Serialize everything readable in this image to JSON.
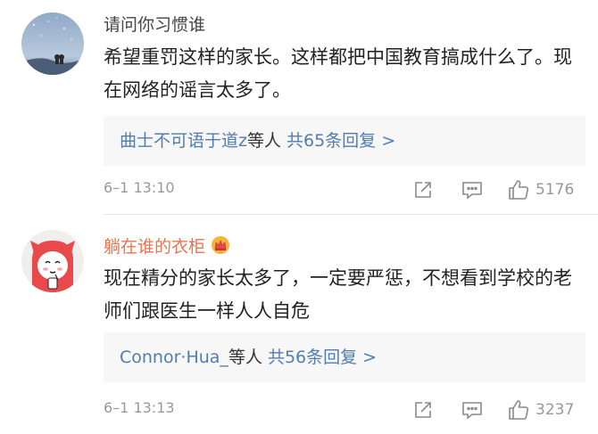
{
  "comments": [
    {
      "username": "请问你习惯谁",
      "text": "希望重罚这样的家长。这样都把中国教育搞成什么了。现在网络的谣言太多了。",
      "replies": {
        "names": "曲士不可语于道z",
        "suffix": "等人",
        "count": "共65条回复 >"
      },
      "time": "6–1 13:10",
      "likes": "5176"
    },
    {
      "username": "躺在谁的衣柜",
      "text": "现在精分的家长太多了，一定要严惩，不想看到学校的老师们跟医生一样人人自危",
      "replies": {
        "names": "Connor·Hua_",
        "suffix": "等人",
        "count": "共56条回复 >"
      },
      "time": "6–1 13:13",
      "likes": "3237"
    }
  ],
  "colors": {
    "link": "#507daf",
    "username_vip": "#eb7350",
    "meta": "#999999"
  },
  "icons": [
    "share-icon",
    "comment-icon",
    "like-icon",
    "vip-crown-icon"
  ]
}
